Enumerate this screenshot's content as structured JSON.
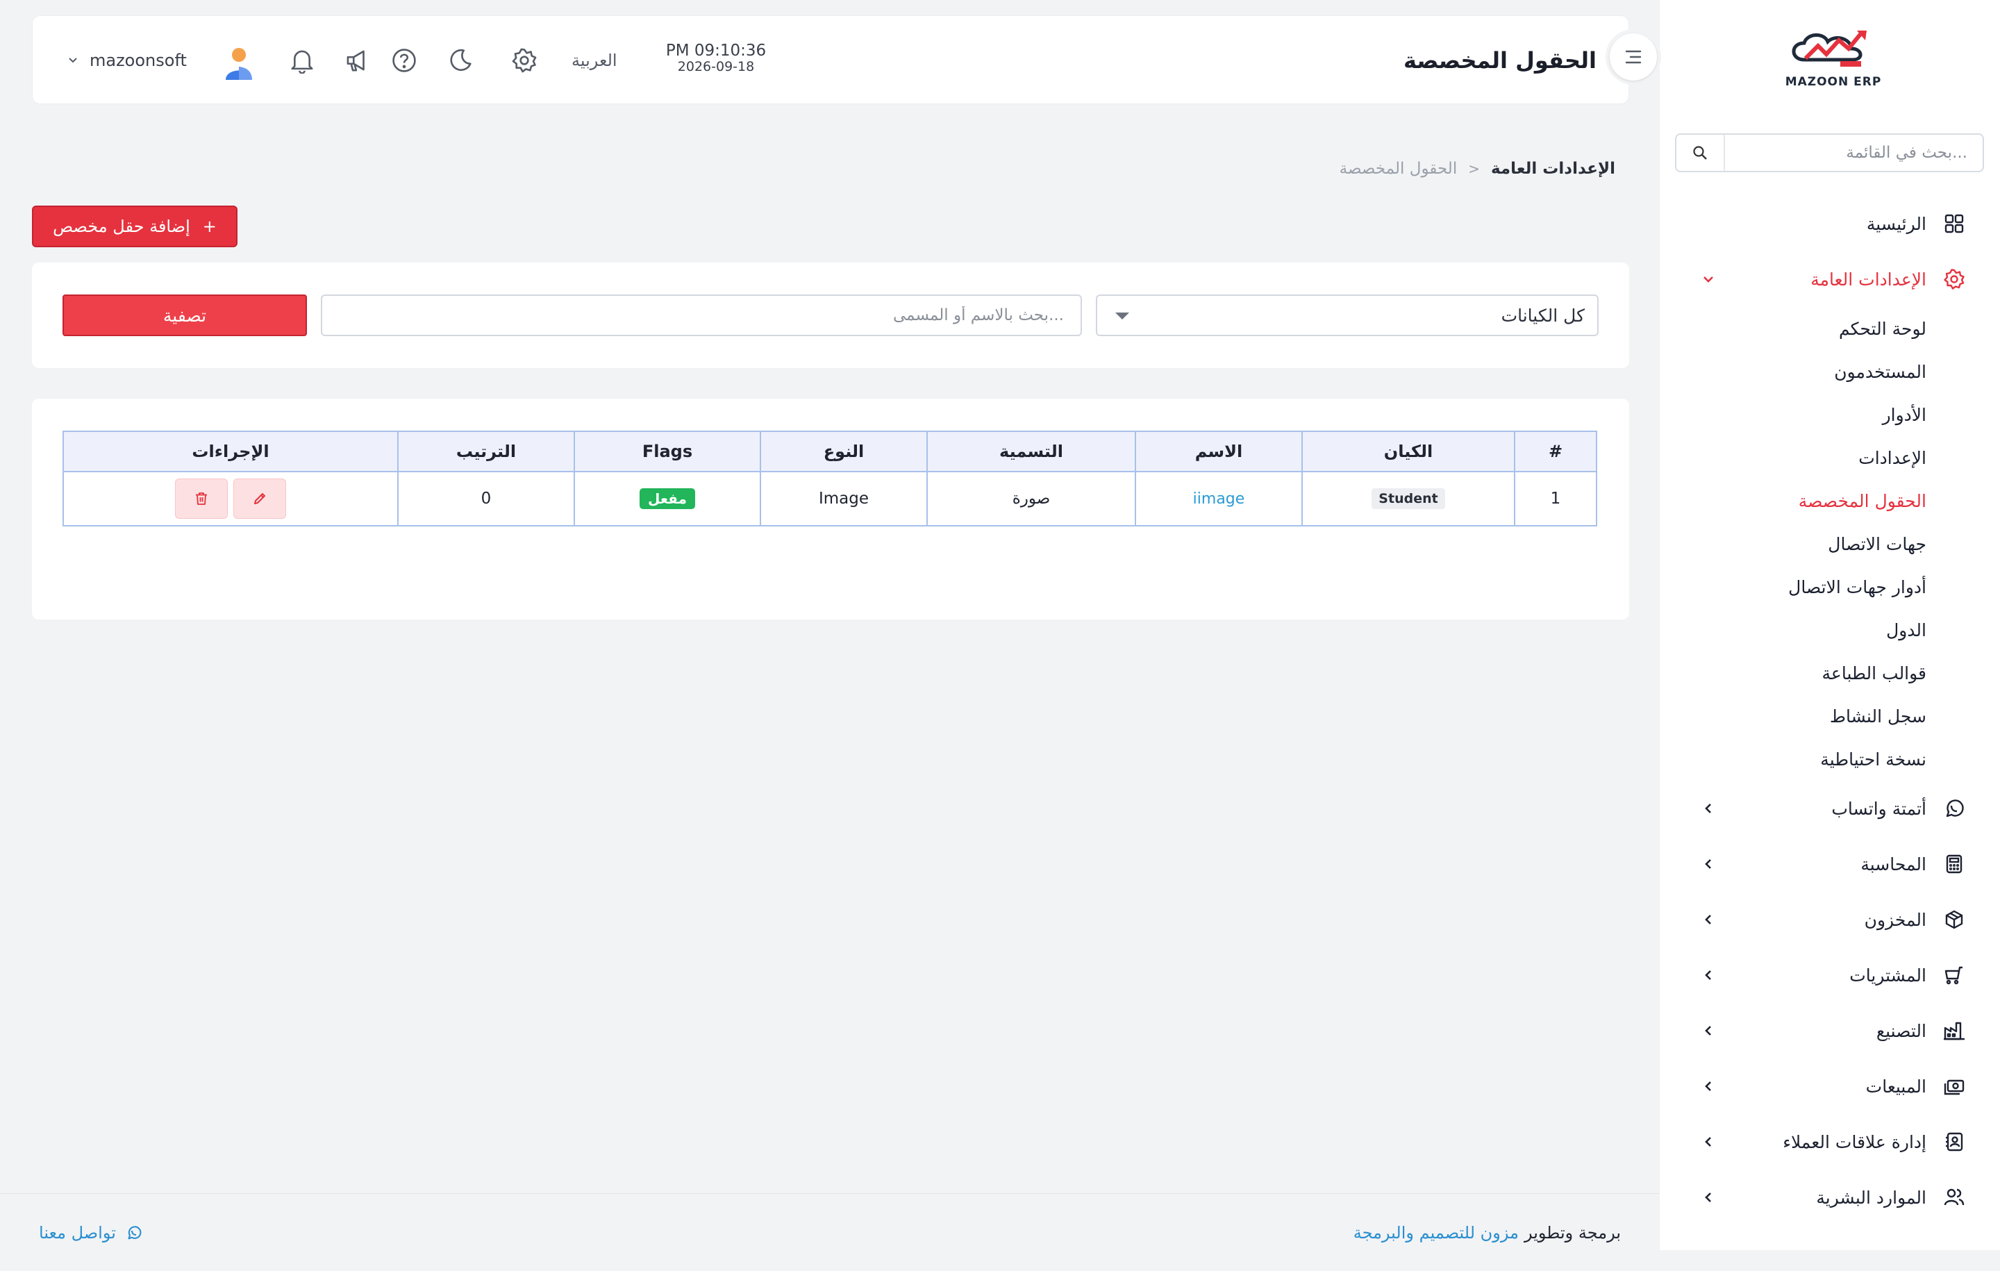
{
  "app": {
    "logo_text": "MAZOON ERP",
    "brand_color": "#e5323e",
    "link_color": "#2a9bd6"
  },
  "header": {
    "title": "الحقول المخصصة",
    "time": "PM 09:10:36",
    "date": "2026-09-18",
    "language": "العربية",
    "username": "mazoonsoft",
    "icons": [
      "menu-toggle-icon",
      "gear-icon",
      "moon-icon",
      "help-icon",
      "megaphone-icon",
      "bell-icon",
      "avatar",
      "chevron-down-icon"
    ]
  },
  "sidebar": {
    "search_placeholder": "بحث في القائمة...",
    "items": [
      {
        "label": "الرئيسية",
        "icon": "grid-icon"
      },
      {
        "label": "الإعدادات العامة",
        "icon": "gear-icon",
        "active": true,
        "expanded": true
      },
      {
        "label": "أتمتة واتساب",
        "icon": "whatsapp-icon"
      },
      {
        "label": "المحاسبة",
        "icon": "calculator-icon"
      },
      {
        "label": "المخزون",
        "icon": "box-icon"
      },
      {
        "label": "المشتريات",
        "icon": "cart-icon"
      },
      {
        "label": "التصنيع",
        "icon": "factory-icon"
      },
      {
        "label": "المبيعات",
        "icon": "cash-icon"
      },
      {
        "label": "إدارة علاقات العملاء",
        "icon": "contacts-icon"
      },
      {
        "label": "الموارد البشرية",
        "icon": "users-icon"
      }
    ],
    "subitems": [
      {
        "label": "لوحة التحكم"
      },
      {
        "label": "المستخدمون"
      },
      {
        "label": "الأدوار"
      },
      {
        "label": "الإعدادات"
      },
      {
        "label": "الحقول المخصصة",
        "active": true
      },
      {
        "label": "جهات الاتصال"
      },
      {
        "label": "أدوار جهات الاتصال"
      },
      {
        "label": "الدول"
      },
      {
        "label": "قوالب الطباعة"
      },
      {
        "label": "سجل النشاط"
      },
      {
        "label": "نسخة احتياطية"
      }
    ]
  },
  "breadcrumb": {
    "root": "الإعدادات العامة",
    "separator": "<",
    "current": "الحقول المخصصة"
  },
  "actions": {
    "add_label": "إضافة حقل مخصص",
    "add_icon": "+"
  },
  "filters": {
    "entity_selected": "كل الكيانات",
    "search_placeholder": "بحث بالاسم أو المسمى...",
    "filter_label": "تصفية"
  },
  "table": {
    "columns": [
      "#",
      "الكيان",
      "الاسم",
      "التسمية",
      "النوع",
      "Flags",
      "الترتيب",
      "الإجراءات"
    ],
    "rows": [
      {
        "index": "1",
        "entity": "Student",
        "name": "iimage",
        "label": "صورة",
        "type": "Image",
        "flag": "مفعل",
        "order": "0"
      }
    ]
  },
  "footer": {
    "credit_prefix": "برمجة وتطوير",
    "credit_brand": "مزون للتصميم والبرمجة",
    "contact": "تواصل معنا"
  }
}
